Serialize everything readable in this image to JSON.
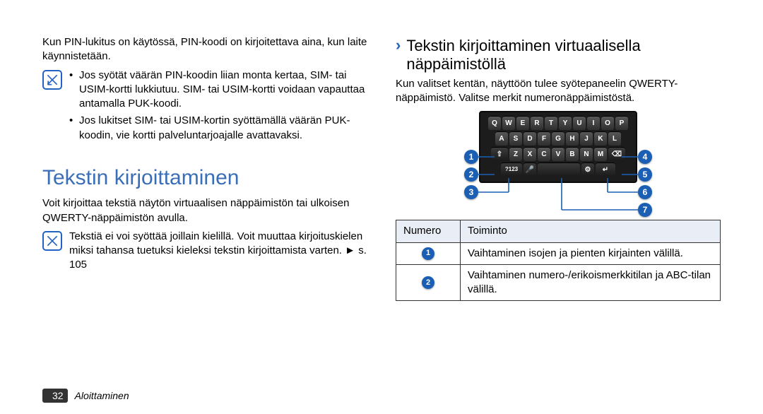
{
  "left": {
    "lead": "Kun PIN-lukitus on käytössä, PIN-koodi on kirjoitettava aina, kun laite käynnistetään.",
    "note_bullets": [
      "Jos syötät väärän PIN-koodin liian monta kertaa, SIM- tai USIM-kortti lukkiutuu. SIM- tai USIM-kortti voidaan vapauttaa antamalla PUK-koodi.",
      "Jos lukitset SIM- tai USIM-kortin syöttämällä väärän PUK-koodin, vie kortti palveluntarjoajalle avattavaksi."
    ],
    "section_title": "Tekstin kirjoittaminen",
    "section_intro": "Voit kirjoittaa tekstiä näytön virtuaalisen näppäimistön tai ulkoisen QWERTY-näppäimistön avulla.",
    "note2_text": "Tekstiä ei voi syöttää joillain kielillä. Voit muuttaa kirjoituskielen miksi tahansa tuetuksi kieleksi tekstin kirjoittamista varten.",
    "note2_ref_arrow": "►",
    "note2_ref": "s. 105"
  },
  "right": {
    "sub_chevron": "›",
    "sub_title": "Tekstin kirjoittaminen virtuaalisella näppäimistöllä",
    "sub_intro": "Kun valitset kentän, näyttöön tulee syötepaneelin QWERTY-näppäimistö. Valitse merkit numeronäppäimistöstä.",
    "keyboard": {
      "row1": [
        "Q",
        "W",
        "E",
        "R",
        "T",
        "Y",
        "U",
        "I",
        "O",
        "P"
      ],
      "row2": [
        "A",
        "S",
        "D",
        "F",
        "G",
        "H",
        "J",
        "K",
        "L"
      ],
      "row3_shift": "⇧",
      "row3": [
        "Z",
        "X",
        "C",
        "V",
        "B",
        "N",
        "M"
      ],
      "row3_bksp": "⌫",
      "row4_mode": "?123",
      "row4_mic": "🎤",
      "row4_space": " ",
      "row4_gear": "⚙",
      "row4_enter": "↵"
    },
    "callouts_left": [
      "1",
      "2",
      "3"
    ],
    "callouts_right": [
      "4",
      "5",
      "6",
      "7"
    ],
    "table": {
      "head_num": "Numero",
      "head_func": "Toiminto",
      "rows": [
        {
          "n": "1",
          "t": "Vaihtaminen isojen ja pienten kirjainten välillä."
        },
        {
          "n": "2",
          "t": "Vaihtaminen numero-/erikoismerkkitilan ja ABC-tilan välillä."
        }
      ]
    }
  },
  "footer": {
    "page_number": "32",
    "section_name": "Aloittaminen"
  }
}
